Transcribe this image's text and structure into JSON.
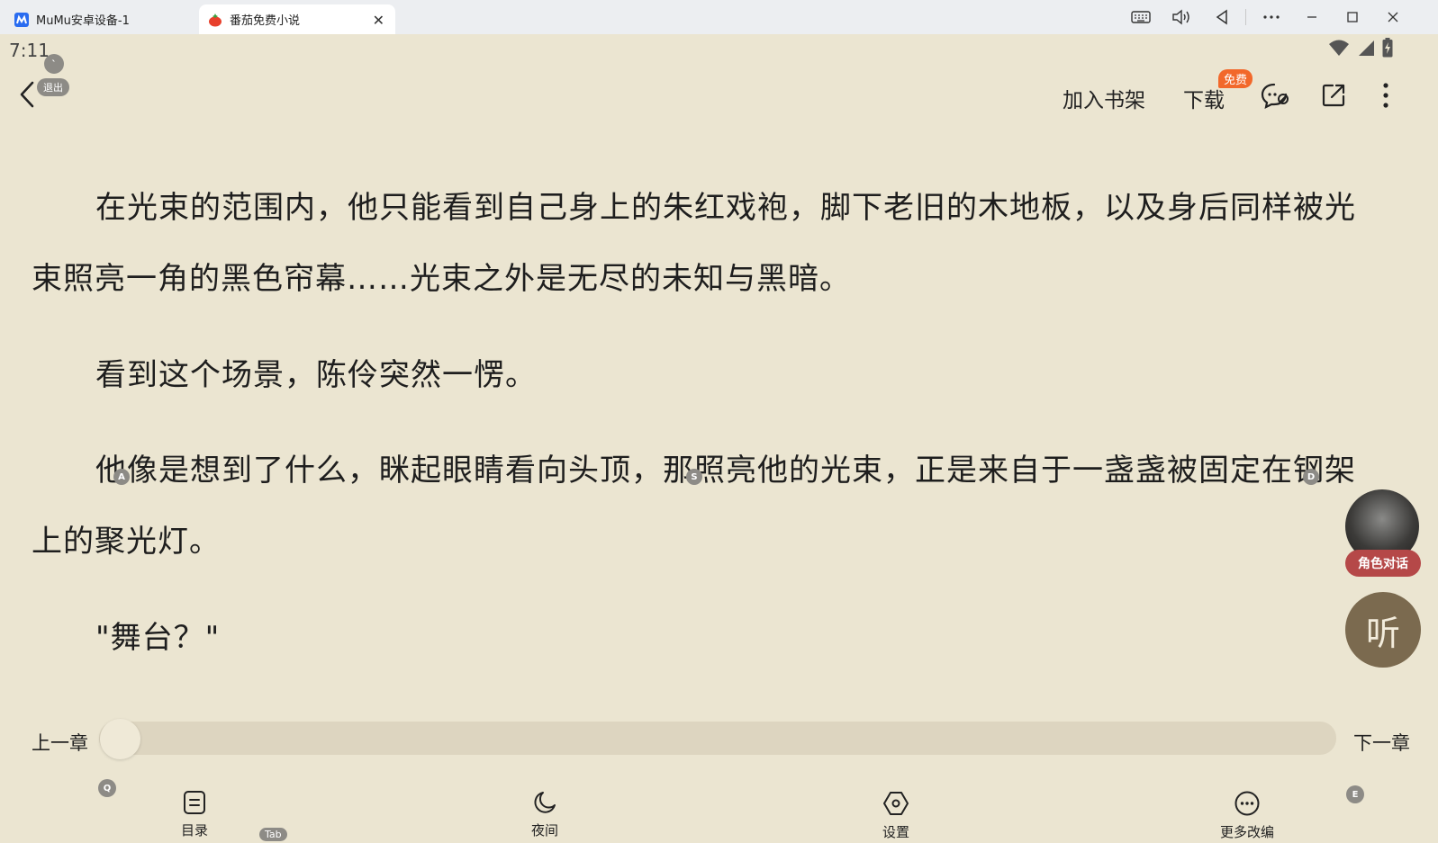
{
  "window": {
    "tabs": [
      {
        "label": "MuMu安卓设备-1",
        "icon": "mumu-icon"
      },
      {
        "label": "番茄免费小说",
        "icon": "tomato-icon"
      }
    ],
    "controls": [
      "keyboard-icon",
      "volume-icon",
      "back-triangle-icon",
      "more-icon",
      "minimize-icon",
      "maximize-icon",
      "close-icon"
    ]
  },
  "status": {
    "time": "7:11"
  },
  "hints": {
    "exit": "退出",
    "backtick": "`",
    "a": "A",
    "s": "S",
    "d": "D",
    "q": "Q",
    "tab": "Tab",
    "e": "E"
  },
  "topbar": {
    "add_shelf": "加入书架",
    "download": "下载",
    "free_badge": "免费"
  },
  "content": {
    "paragraphs": [
      "在光束的范围内，他只能看到自己身上的朱红戏袍，脚下老旧的木地板，以及身后同样被光束照亮一角的黑色帘幕……光束之外是无尽的未知与黑暗。",
      "看到这个场景，陈伶突然一愣。",
      "他像是想到了什么，眯起眼睛看向头顶，那照亮他的光束，正是来自于一盏盏被固定在钢架上的聚光灯。",
      "\"舞台？\""
    ]
  },
  "floating": {
    "role_chat": "角色对话",
    "listen": "听"
  },
  "progress": {
    "prev": "上一章",
    "next": "下一章",
    "value": 0.0
  },
  "bottom_menu": {
    "toc": "目录",
    "night": "夜间",
    "settings": "设置",
    "more": "更多改编"
  },
  "colors": {
    "background": "#ebe5d1",
    "badge": "#f2682a",
    "role_chat": "#b54848",
    "listen": "#7b6a4f"
  }
}
